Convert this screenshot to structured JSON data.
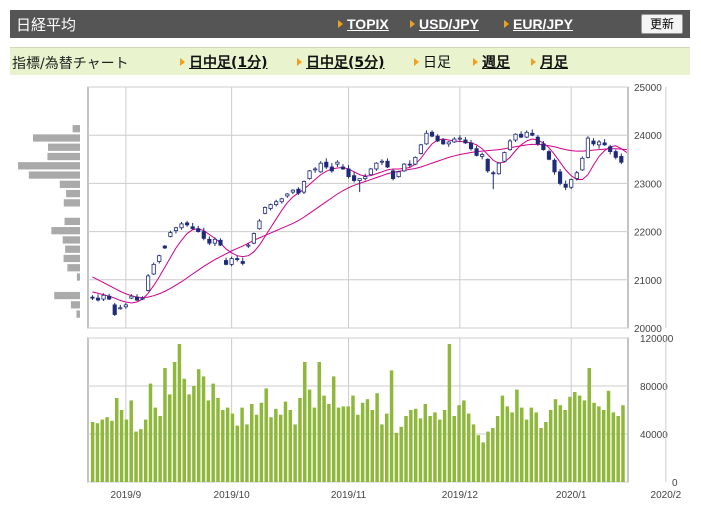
{
  "header": {
    "title": "日経平均",
    "links": [
      "TOPIX",
      "USD/JPY",
      "EUR/JPY"
    ],
    "refresh_label": "更新"
  },
  "subheader": {
    "label": "指標/為替チャート",
    "tabs": [
      {
        "label": "日中足(1分)",
        "active": false
      },
      {
        "label": "日中足(5分)",
        "active": false
      },
      {
        "label": "日足",
        "active": true
      },
      {
        "label": "週足",
        "active": false
      },
      {
        "label": "月足",
        "active": false
      }
    ]
  },
  "colors": {
    "up": "#ffffff",
    "down": "#1f2a7a",
    "ma_short": "#d0008c",
    "ma_long": "#d0008c",
    "volume": "#8db83a",
    "volume_profile": "#aaaaaa"
  },
  "chart_data": [
    {
      "type": "candlestick",
      "ylim": [
        20000,
        25000
      ],
      "yticks": [
        20000,
        21000,
        22000,
        23000,
        24000,
        25000
      ],
      "x_tick_labels": [
        "2019/9",
        "2019/10",
        "2019/11",
        "2019/12",
        "2020/1",
        "2020/2"
      ],
      "x_tick_index": [
        6,
        25,
        46,
        66,
        86,
        103
      ],
      "series": [
        {
          "ohlc": [
            [
              20640,
              20680,
              20580,
              20620
            ],
            [
              20620,
              20700,
              20550,
              20580
            ],
            [
              20600,
              20720,
              20560,
              20680
            ],
            [
              20660,
              20710,
              20580,
              20600
            ],
            [
              20480,
              20520,
              20250,
              20280
            ],
            [
              20420,
              20480,
              20380,
              20420
            ],
            [
              20440,
              20520,
              20400,
              20480
            ],
            [
              20620,
              20700,
              20600,
              20660
            ],
            [
              20640,
              20700,
              20560,
              20580
            ],
            [
              20600,
              20660,
              20580,
              20620
            ],
            [
              20780,
              21120,
              20760,
              21080
            ],
            [
              21120,
              21360,
              21100,
              21320
            ],
            [
              21380,
              21520,
              21340,
              21500
            ],
            [
              21700,
              21720,
              21640,
              21660
            ],
            [
              21900,
              22020,
              21880,
              21980
            ],
            [
              22020,
              22100,
              21960,
              22080
            ],
            [
              22080,
              22200,
              22040,
              22160
            ],
            [
              22180,
              22220,
              22100,
              22140
            ],
            [
              22100,
              22180,
              22040,
              22060
            ],
            [
              22060,
              22120,
              21980,
              22000
            ],
            [
              22000,
              22080,
              21820,
              21860
            ],
            [
              21840,
              21900,
              21720,
              21760
            ],
            [
              21760,
              21880,
              21700,
              21840
            ],
            [
              21820,
              21860,
              21700,
              21720
            ],
            [
              21400,
              21460,
              21300,
              21320
            ],
            [
              21320,
              21480,
              21280,
              21440
            ],
            [
              21440,
              21500,
              21380,
              21420
            ],
            [
              21380,
              21460,
              21300,
              21340
            ],
            [
              21700,
              21760,
              21660,
              21720
            ],
            [
              21760,
              21980,
              21740,
              21960
            ],
            [
              22060,
              22260,
              22040,
              22220
            ],
            [
              22380,
              22520,
              22360,
              22500
            ],
            [
              22480,
              22580,
              22440,
              22560
            ],
            [
              22560,
              22660,
              22520,
              22620
            ],
            [
              22620,
              22700,
              22580,
              22680
            ],
            [
              22740,
              22800,
              22700,
              22780
            ],
            [
              22820,
              22880,
              22780,
              22860
            ],
            [
              22880,
              22920,
              22760,
              22800
            ],
            [
              22820,
              23060,
              22780,
              23040
            ],
            [
              23100,
              23280,
              23080,
              23260
            ],
            [
              23280,
              23340,
              23220,
              23300
            ],
            [
              23240,
              23460,
              23220,
              23420
            ],
            [
              23440,
              23520,
              23300,
              23340
            ],
            [
              23340,
              23420,
              23220,
              23260
            ],
            [
              23400,
              23480,
              23340,
              23440
            ],
            [
              23340,
              23400,
              23280,
              23300
            ],
            [
              23300,
              23380,
              23100,
              23140
            ],
            [
              23160,
              23240,
              23020,
              23060
            ],
            [
              23060,
              23100,
              22820,
              23100
            ],
            [
              23100,
              23200,
              23060,
              23140
            ],
            [
              23180,
              23320,
              23160,
              23300
            ],
            [
              23300,
              23440,
              23260,
              23420
            ],
            [
              23440,
              23500,
              23380,
              23460
            ],
            [
              23460,
              23520,
              23320,
              23340
            ],
            [
              23260,
              23300,
              23060,
              23100
            ],
            [
              23140,
              23260,
              23120,
              23240
            ],
            [
              23260,
              23420,
              23240,
              23400
            ],
            [
              23400,
              23480,
              23340,
              23380
            ],
            [
              23400,
              23560,
              23380,
              23540
            ],
            [
              23620,
              23820,
              23600,
              23800
            ],
            [
              23820,
              24100,
              23800,
              24040
            ],
            [
              24060,
              24100,
              23960,
              23980
            ],
            [
              23980,
              24020,
              23860,
              23880
            ],
            [
              23900,
              23940,
              23800,
              23820
            ],
            [
              23820,
              23880,
              23760,
              23860
            ],
            [
              23860,
              23960,
              23840,
              23920
            ],
            [
              23920,
              24000,
              23860,
              23940
            ],
            [
              23900,
              23960,
              23820,
              23840
            ],
            [
              23840,
              23900,
              23680,
              23720
            ],
            [
              23720,
              23780,
              23560,
              23580
            ],
            [
              23560,
              23640,
              23500,
              23600
            ],
            [
              23500,
              23520,
              23220,
              23260
            ],
            [
              23220,
              23260,
              22880,
              23200
            ],
            [
              23200,
              23440,
              23180,
              23420
            ],
            [
              23460,
              23660,
              23440,
              23640
            ],
            [
              23700,
              23920,
              23680,
              23880
            ],
            [
              23900,
              24040,
              23860,
              24020
            ],
            [
              24020,
              24080,
              23940,
              23960
            ],
            [
              23960,
              24100,
              23940,
              24060
            ],
            [
              24040,
              24120,
              23980,
              24000
            ],
            [
              23960,
              24000,
              23780,
              23820
            ],
            [
              23820,
              23880,
              23680,
              23700
            ],
            [
              23660,
              23700,
              23480,
              23500
            ],
            [
              23480,
              23520,
              23180,
              23240
            ],
            [
              23240,
              23300,
              22960,
              23000
            ],
            [
              22980,
              23060,
              22860,
              22920
            ],
            [
              22920,
              23100,
              22880,
              23080
            ],
            [
              23100,
              23260,
              23060,
              23220
            ],
            [
              23280,
              23560,
              23260,
              23520
            ],
            [
              23540,
              23980,
              23520,
              23940
            ],
            [
              23880,
              23940,
              23780,
              23820
            ],
            [
              23800,
              23900,
              23720,
              23860
            ],
            [
              23840,
              23920,
              23780,
              23800
            ],
            [
              23760,
              23800,
              23600,
              23660
            ],
            [
              23660,
              23700,
              23500,
              23540
            ],
            [
              23560,
              23620,
              23400,
              23440
            ]
          ]
        },
        {
          "name": "ma_short",
          "values": [
            20750,
            20720,
            20690,
            20660,
            20620,
            20570,
            20540,
            20520,
            20540,
            20600,
            20720,
            20880,
            21060,
            21260,
            21460,
            21660,
            21820,
            21960,
            22040,
            22060,
            22020,
            21940,
            21860,
            21760,
            21640,
            21560,
            21500,
            21480,
            21500,
            21580,
            21720,
            21900,
            22080,
            22260,
            22440,
            22600,
            22720,
            22800,
            22880,
            22980,
            23080,
            23180,
            23250,
            23300,
            23320,
            23330,
            23300,
            23240,
            23180,
            23150,
            23160,
            23200,
            23240,
            23280,
            23300,
            23300,
            23310,
            23330,
            23400,
            23520,
            23680,
            23820,
            23900,
            23920,
            23900,
            23880,
            23870,
            23860,
            23840,
            23800,
            23720,
            23600,
            23480,
            23420,
            23440,
            23540,
            23680,
            23800,
            23880,
            23920,
            23900,
            23840,
            23740,
            23600,
            23440,
            23280,
            23160,
            23080,
            23080,
            23180,
            23380,
            23560,
            23680,
            23760,
            23780,
            23720,
            23640
          ]
        },
        {
          "name": "ma_long",
          "values": [
            21060,
            21000,
            20940,
            20880,
            20820,
            20760,
            20710,
            20670,
            20640,
            20630,
            20640,
            20670,
            20710,
            20760,
            20820,
            20890,
            20960,
            21040,
            21120,
            21200,
            21280,
            21350,
            21420,
            21480,
            21540,
            21600,
            21650,
            21700,
            21760,
            21820,
            21870,
            21920,
            21970,
            22020,
            22070,
            22120,
            22170,
            22230,
            22300,
            22380,
            22460,
            22540,
            22620,
            22700,
            22780,
            22850,
            22910,
            22960,
            23000,
            23040,
            23080,
            23120,
            23160,
            23200,
            23230,
            23250,
            23270,
            23290,
            23310,
            23340,
            23380,
            23420,
            23460,
            23500,
            23540,
            23570,
            23600,
            23620,
            23640,
            23660,
            23670,
            23680,
            23690,
            23700,
            23720,
            23740,
            23760,
            23780,
            23800,
            23810,
            23810,
            23800,
            23780,
            23760,
            23730,
            23700,
            23680,
            23670,
            23670,
            23680,
            23690,
            23700,
            23710,
            23720,
            23720,
            23710,
            23700
          ]
        }
      ]
    },
    {
      "type": "bar",
      "ylim": [
        0,
        120000
      ],
      "yticks": [
        0,
        40000,
        80000,
        120000
      ],
      "series": [
        {
          "name": "volume",
          "values": [
            50000,
            49000,
            52000,
            54000,
            51000,
            70000,
            60000,
            52000,
            68000,
            42000,
            44000,
            52000,
            82000,
            62000,
            55000,
            95000,
            73000,
            100000,
            115000,
            86000,
            73000,
            80000,
            94000,
            88000,
            68000,
            82000,
            70000,
            60000,
            62000,
            57000,
            47000,
            62000,
            48000,
            65000,
            56000,
            66000,
            78000,
            54000,
            61000,
            56000,
            67000,
            60000,
            48000,
            70000,
            100000,
            77000,
            62000,
            100000,
            72000,
            65000,
            88000,
            62000,
            63000,
            63000,
            72000,
            56000,
            66000,
            69000,
            60000,
            74000,
            48000,
            57000,
            93000,
            41000,
            46000,
            55000,
            60000,
            61000,
            53000,
            65000,
            55000,
            58000,
            52000,
            60000,
            115000,
            55000,
            64000,
            68000,
            57000,
            48000,
            39000,
            33000,
            42000,
            45000,
            55000,
            72000,
            63000,
            58000,
            77000,
            62000,
            52000,
            62000,
            58000,
            45000,
            50000,
            60000,
            69000,
            64000,
            60000,
            71000,
            75000,
            72000,
            68000,
            95000,
            66000,
            63000,
            60000,
            76000,
            58000,
            55000,
            64000
          ]
        }
      ]
    }
  ]
}
